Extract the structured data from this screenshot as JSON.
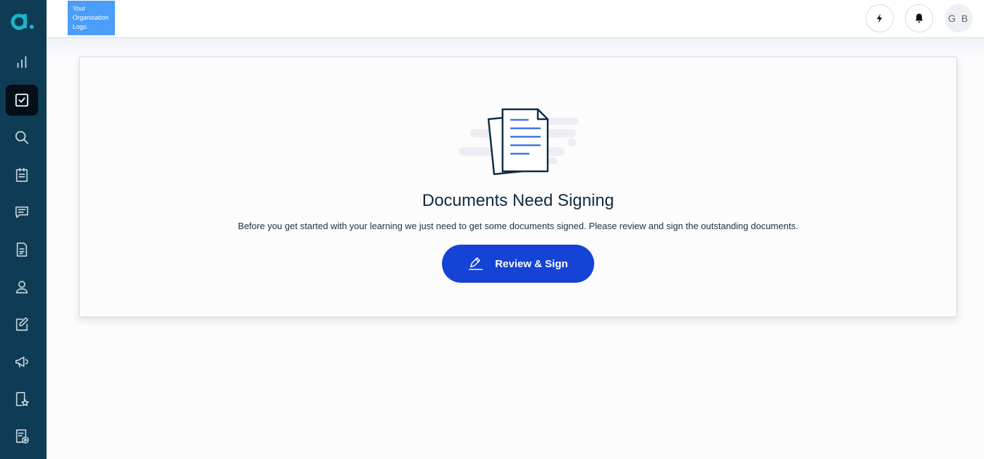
{
  "header": {
    "org_logo_text": "Your\nOrganisation\nLogo",
    "avatar_initials": "G B"
  },
  "sidebar": {
    "items": [
      {
        "icon": "bar-chart-icon"
      },
      {
        "icon": "checkbox-icon",
        "active": true
      },
      {
        "icon": "search-icon"
      },
      {
        "icon": "clipboard-icon"
      },
      {
        "icon": "chat-icon"
      },
      {
        "icon": "document-icon"
      },
      {
        "icon": "user-icon"
      },
      {
        "icon": "edit-icon"
      },
      {
        "icon": "megaphone-icon"
      },
      {
        "icon": "bookmark-star-icon"
      },
      {
        "icon": "document-play-icon"
      }
    ]
  },
  "main": {
    "title": "Documents Need Signing",
    "description": "Before you get started with your learning we just need to get some documents signed. Please review and sign the outstanding documents.",
    "button_label": "Review & Sign"
  },
  "colors": {
    "sidebar_bg": "#0e3c55",
    "brand_teal": "#19b5c9",
    "primary_button": "#1443d6",
    "org_logo_bg": "#4a9ef8"
  }
}
